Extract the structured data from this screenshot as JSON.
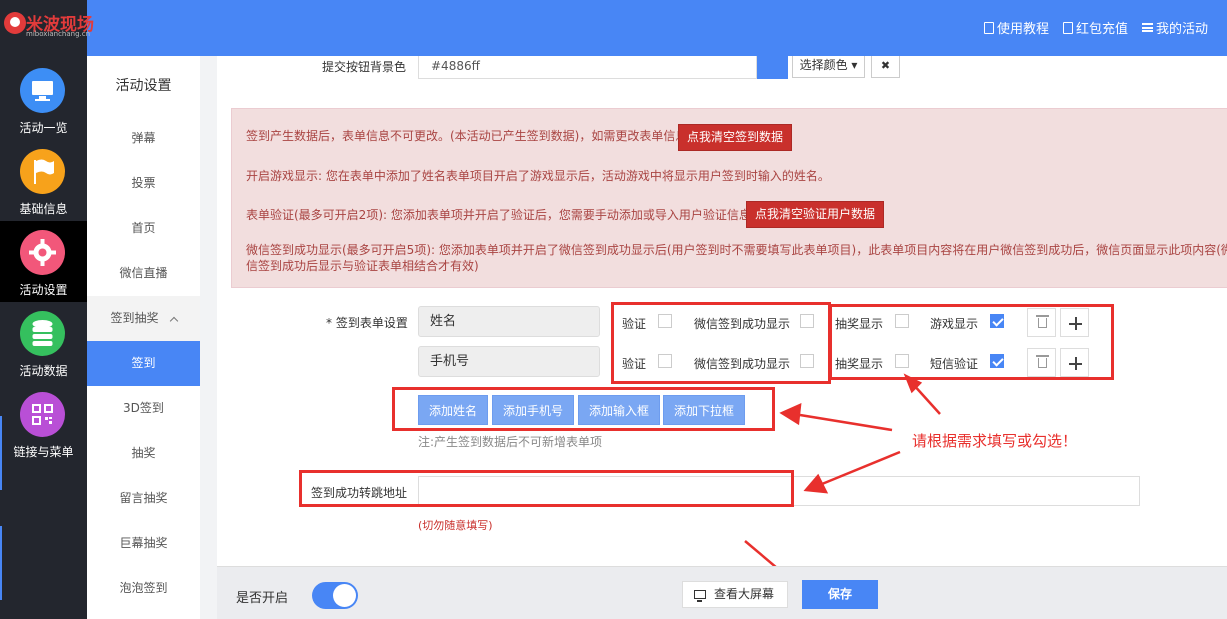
{
  "brand": {
    "name": "米波现场",
    "domain": "miboxianchang.cn"
  },
  "topnav": [
    {
      "label": "使用教程",
      "icon": "document-icon"
    },
    {
      "label": "红包充值",
      "icon": "document-icon"
    },
    {
      "label": "我的活动",
      "icon": "menu-icon"
    }
  ],
  "sidebar": [
    {
      "label": "活动一览",
      "icon": "monitor-icon",
      "color": "#3d8ef5"
    },
    {
      "label": "基础信息",
      "icon": "flag-icon",
      "color": "#f7a21b"
    },
    {
      "label": "活动设置",
      "icon": "gear-icon",
      "color": "#f2577a",
      "active": true
    },
    {
      "label": "活动数据",
      "icon": "database-icon",
      "color": "#35c05e"
    },
    {
      "label": "链接与菜单",
      "icon": "qrcode-icon",
      "color": "#b94fd6"
    }
  ],
  "subnav": {
    "title": "活动设置",
    "items": [
      "弹幕",
      "投票",
      "首页",
      "微信直播",
      "签到抽奖",
      "签到",
      "3D签到",
      "抽奖",
      "留言抽奖",
      "巨幕抽奖",
      "泡泡签到"
    ]
  },
  "submit_bg": {
    "label": "提交按钮背景色",
    "value": "#4886ff",
    "color": "#4886f5",
    "pick_label": "选择颜色 ▾",
    "clear_label": "✖"
  },
  "alert": {
    "line1": "签到产生数据后，表单信息不可更改。(本活动已产生签到数据)，如需更改表单信息",
    "btn1": "点我清空签到数据",
    "line2": "开启游戏显示: 您在表单中添加了姓名表单项目开启了游戏显示后，活动游戏中将显示用户签到时输入的姓名。",
    "line3": "表单验证(最多可开启2项): 您添加表单项并开启了验证后，您需要手动添加或导入用户验证信息。",
    "btn2": "点我清空验证用户数据",
    "line4": "微信签到成功显示(最多可开启5项): 您添加表单项并开启了微信签到成功显示后(用户签到时不需要填写此表单项目)，此表单项目内容将在用户微信签到成功后，微信页面显示此项内容(微信签到成功后显示与验证表单相结合才有效)"
  },
  "form": {
    "label": "* 签到表单设置",
    "rows": [
      {
        "field": "姓名",
        "verify": "验证",
        "wx_show": "微信签到成功显示",
        "lottery": "抽奖显示",
        "extra": "游戏显示",
        "extra_checked": true
      },
      {
        "field": "手机号",
        "verify": "验证",
        "wx_show": "微信签到成功显示",
        "lottery": "抽奖显示",
        "extra": "短信验证",
        "extra_checked": true
      }
    ],
    "add_buttons": [
      "添加姓名",
      "添加手机号",
      "添加输入框",
      "添加下拉框"
    ],
    "note": "注:产生签到数据后不可新增表单项"
  },
  "redirect": {
    "label": "签到成功转跳地址",
    "value": "",
    "hint": "(切勿随意填写)"
  },
  "annotation": "请根据需求填写或勾选！",
  "bottom": {
    "enable_label": "是否开启",
    "enabled": true,
    "preview_label": "查看大屏幕",
    "save_label": "保存"
  }
}
